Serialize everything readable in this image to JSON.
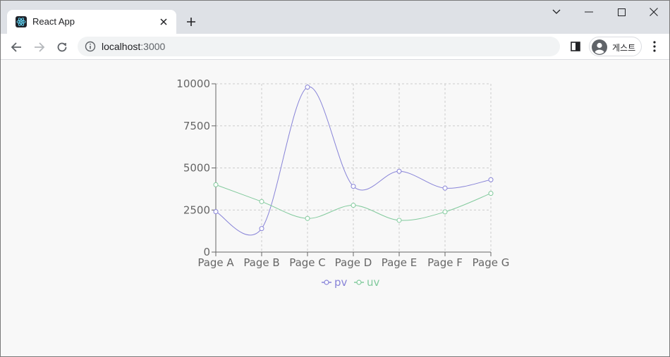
{
  "browser": {
    "tab": {
      "title": "React App",
      "favicon": "react-logo-icon"
    },
    "address": {
      "host": "localhost",
      "port": ":3000"
    },
    "profile": {
      "name": "게스트"
    },
    "icons": {
      "close": "close-icon",
      "new_tab": "plus-icon",
      "back": "arrow-left-icon",
      "forward": "arrow-right-icon",
      "reload": "reload-icon",
      "info": "info-icon",
      "side_panel": "side-panel-icon",
      "menu": "kebab-menu-icon",
      "tab_search": "chevron-down-icon",
      "minimize": "minimize-icon",
      "maximize": "maximize-icon",
      "window_close": "close-icon"
    }
  },
  "chart_data": {
    "type": "line",
    "categories": [
      "Page A",
      "Page B",
      "Page C",
      "Page D",
      "Page E",
      "Page F",
      "Page G"
    ],
    "series": [
      {
        "name": "pv",
        "color": "#8884d8",
        "values": [
          2400,
          1398,
          9800,
          3908,
          4800,
          3800,
          4300
        ]
      },
      {
        "name": "uv",
        "color": "#82ca9d",
        "values": [
          4000,
          3000,
          2000,
          2780,
          1890,
          2390,
          3490
        ]
      }
    ],
    "yticks": [
      "0",
      "2500",
      "5000",
      "7500",
      "10000"
    ],
    "ylim": [
      0,
      10000
    ],
    "grid": true,
    "legend_position": "bottom"
  }
}
